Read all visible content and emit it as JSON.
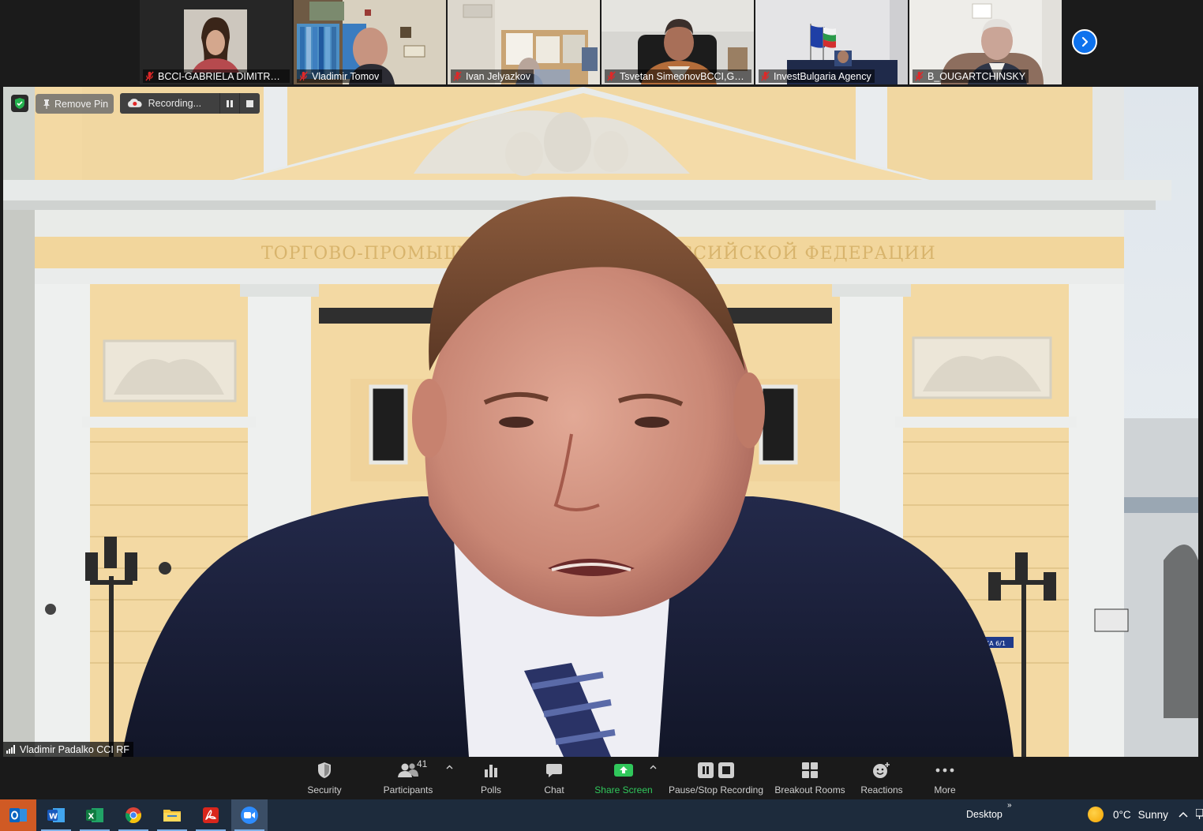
{
  "thumbnails": [
    {
      "name": "BCCI-GABRIELA DIMITROVA",
      "mic": "muted"
    },
    {
      "name": "Vladimir Tomov",
      "mic": "muted"
    },
    {
      "name": "Ivan Jelyazkov",
      "mic": "muted"
    },
    {
      "name": "Tsvetan SimeonovBCCI,GS1...",
      "mic": "muted"
    },
    {
      "name": "InvestBulgaria Agency",
      "mic": "muted"
    },
    {
      "name": "B_OUGARTCHINSKY",
      "mic": "muted"
    }
  ],
  "strip_next_icon": "chevron-right-icon",
  "main_video": {
    "pin_button": "Remove Pin",
    "recording_status": "Recording...",
    "speaker_name": "Vladimir Padalko CCI RF",
    "building_inscription": "ТОРГОВО-ПРОМЫШЛЕННАЯ ПАЛАТА РОССИЙСКОЙ ФЕДЕРАЦИИ",
    "street_sign": "ИЛЬИНКА 6/1"
  },
  "toolbar": {
    "security": "Security",
    "participants": "Participants",
    "participants_count": "41",
    "polls": "Polls",
    "chat": "Chat",
    "share_screen": "Share Screen",
    "pause_stop_recording": "Pause/Stop Recording",
    "breakout_rooms": "Breakout Rooms",
    "reactions": "Reactions",
    "more": "More"
  },
  "colors": {
    "accent_blue": "#0e72ed",
    "share_green": "#30c75b",
    "muted_red": "#e02828",
    "taskbar": "#1d2b3c",
    "toolbar": "#1a1a1a"
  },
  "taskbar": {
    "apps": [
      "outlook",
      "word",
      "excel",
      "chrome",
      "file-explorer",
      "acrobat",
      "zoom"
    ],
    "desktop_label": "Desktop",
    "weather_temp": "0°C",
    "weather_text": "Sunny"
  }
}
